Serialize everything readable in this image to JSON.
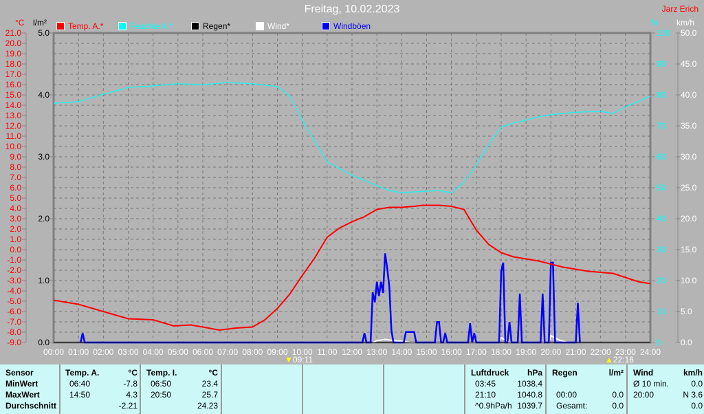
{
  "title": "Freitag, 10.02.2023",
  "author": "Jarz Erich",
  "legend": [
    {
      "label": "Temp. A.*",
      "color": "#ff0000"
    },
    {
      "label": "Feuchte A.*",
      "color": "#00ffff"
    },
    {
      "label": "Regen*",
      "color": "#000000"
    },
    {
      "label": "Wind*",
      "color": "#ffffff"
    },
    {
      "label": "Windböen",
      "color": "#0000ff"
    }
  ],
  "units": {
    "temp": "°C",
    "rain": "l/m²",
    "hum": "%",
    "wind": "km/h"
  },
  "sun": {
    "rise": "09:11",
    "set": "22:16"
  },
  "chart_data": {
    "type": "line",
    "x_ticks": [
      "00:00",
      "01:00",
      "02:00",
      "03:00",
      "04:00",
      "05:00",
      "06:00",
      "07:00",
      "08:00",
      "09:00",
      "10:00",
      "11:00",
      "12:00",
      "13:00",
      "14:00",
      "15:00",
      "16:00",
      "17:00",
      "18:00",
      "19:00",
      "20:00",
      "21:00",
      "22:00",
      "23:00",
      "24:00"
    ],
    "axes": {
      "temp": {
        "label": "°C",
        "range": [
          -9,
          21
        ],
        "step": 1,
        "color": "#ff0000"
      },
      "rain": {
        "label": "l/m²",
        "range": [
          0,
          5
        ],
        "step": 1
      },
      "humidity": {
        "label": "%",
        "range": [
          0,
          100
        ],
        "step": 10,
        "color": "#00ffff"
      },
      "wind": {
        "label": "km/h",
        "range": [
          0,
          50
        ],
        "step": 5
      }
    },
    "grid": true,
    "series": [
      {
        "name": "Temp. A.*",
        "color": "#ff0000",
        "points": [
          [
            "00:00",
            -4.9
          ],
          [
            "01:00",
            -5.3
          ],
          [
            "02:00",
            -6.0
          ],
          [
            "03:00",
            -6.7
          ],
          [
            "04:00",
            -6.8
          ],
          [
            "04:50",
            -7.4
          ],
          [
            "05:30",
            -7.3
          ],
          [
            "06:00",
            -7.5
          ],
          [
            "06:40",
            -7.8
          ],
          [
            "07:20",
            -7.6
          ],
          [
            "08:00",
            -7.5
          ],
          [
            "08:30",
            -6.8
          ],
          [
            "09:00",
            -5.7
          ],
          [
            "09:30",
            -4.3
          ],
          [
            "10:00",
            -2.5
          ],
          [
            "10:30",
            -0.8
          ],
          [
            "11:00",
            1.2
          ],
          [
            "11:30",
            2.1
          ],
          [
            "12:00",
            2.7
          ],
          [
            "12:30",
            3.2
          ],
          [
            "13:00",
            3.9
          ],
          [
            "13:30",
            4.1
          ],
          [
            "14:00",
            4.1
          ],
          [
            "14:30",
            4.2
          ],
          [
            "14:50",
            4.3
          ],
          [
            "15:30",
            4.3
          ],
          [
            "16:00",
            4.2
          ],
          [
            "16:30",
            3.9
          ],
          [
            "17:00",
            1.9
          ],
          [
            "17:30",
            0.5
          ],
          [
            "18:00",
            -0.3
          ],
          [
            "18:30",
            -0.7
          ],
          [
            "19:00",
            -0.9
          ],
          [
            "19:30",
            -1.1
          ],
          [
            "20:00",
            -1.4
          ],
          [
            "20:30",
            -1.7
          ],
          [
            "21:00",
            -1.9
          ],
          [
            "21:30",
            -2.1
          ],
          [
            "22:00",
            -2.2
          ],
          [
            "22:30",
            -2.3
          ],
          [
            "23:00",
            -2.7
          ],
          [
            "23:30",
            -3.1
          ],
          [
            "24:00",
            -3.3
          ]
        ]
      },
      {
        "name": "Feuchte A.*",
        "color": "#00ffff",
        "points": [
          [
            "00:00",
            77.3
          ],
          [
            "01:00",
            77.8
          ],
          [
            "02:00",
            80.2
          ],
          [
            "03:00",
            82.4
          ],
          [
            "04:00",
            82.9
          ],
          [
            "05:00",
            83.6
          ],
          [
            "06:00",
            83.3
          ],
          [
            "07:00",
            84.0
          ],
          [
            "08:00",
            83.6
          ],
          [
            "09:00",
            82.7
          ],
          [
            "09:30",
            79.6
          ],
          [
            "10:00",
            71.8
          ],
          [
            "10:30",
            65.1
          ],
          [
            "11:00",
            58.4
          ],
          [
            "12:00",
            54.0
          ],
          [
            "12:30",
            52.4
          ],
          [
            "13:00",
            50.7
          ],
          [
            "13:30",
            49.1
          ],
          [
            "14:00",
            48.4
          ],
          [
            "15:00",
            48.9
          ],
          [
            "15:30",
            49.1
          ],
          [
            "16:00",
            48.4
          ],
          [
            "16:30",
            51.8
          ],
          [
            "17:00",
            57.3
          ],
          [
            "17:30",
            64.0
          ],
          [
            "18:00",
            69.6
          ],
          [
            "18:30",
            70.9
          ],
          [
            "19:00",
            71.8
          ],
          [
            "19:30",
            72.9
          ],
          [
            "20:00",
            73.6
          ],
          [
            "21:00",
            74.4
          ],
          [
            "22:00",
            74.7
          ],
          [
            "22:30",
            74.0
          ],
          [
            "23:00",
            76.2
          ],
          [
            "23:30",
            77.8
          ],
          [
            "24:00",
            79.6
          ]
        ]
      },
      {
        "name": "Regen*",
        "color": "#000000",
        "points": [
          [
            "00:00",
            0
          ],
          [
            "24:00",
            0
          ]
        ]
      },
      {
        "name": "Wind*",
        "color": "#ffffff",
        "points": [
          [
            "12:50",
            0
          ],
          [
            "13:00",
            0.3
          ],
          [
            "13:20",
            0.5
          ],
          [
            "13:40",
            0.3
          ],
          [
            "14:00",
            0.2
          ],
          [
            "14:20",
            0
          ],
          [
            "17:55",
            0
          ],
          [
            "18:00",
            0.8
          ],
          [
            "18:20",
            0
          ],
          [
            "19:55",
            0
          ],
          [
            "20:00",
            1.1
          ],
          [
            "20:20",
            0.4
          ],
          [
            "20:40",
            0
          ]
        ]
      },
      {
        "name": "Windböen",
        "color": "#0000ff",
        "points": [
          [
            "01:05",
            0
          ],
          [
            "01:10",
            1.5
          ],
          [
            "01:15",
            0
          ],
          [
            "12:25",
            0
          ],
          [
            "12:30",
            1.5
          ],
          [
            "12:35",
            0
          ],
          [
            "12:45",
            0
          ],
          [
            "12:50",
            8.1
          ],
          [
            "12:55",
            6.5
          ],
          [
            "13:00",
            9.8
          ],
          [
            "13:05",
            7.5
          ],
          [
            "13:10",
            9.8
          ],
          [
            "13:15",
            8.0
          ],
          [
            "13:20",
            14.4
          ],
          [
            "13:25",
            12.0
          ],
          [
            "13:30",
            9.0
          ],
          [
            "13:35",
            2.0
          ],
          [
            "13:40",
            0
          ],
          [
            "14:05",
            0
          ],
          [
            "14:10",
            1.7
          ],
          [
            "14:30",
            1.7
          ],
          [
            "14:35",
            0
          ],
          [
            "15:20",
            0
          ],
          [
            "15:25",
            3.3
          ],
          [
            "15:30",
            3.3
          ],
          [
            "15:35",
            0
          ],
          [
            "15:40",
            0
          ],
          [
            "15:45",
            1.5
          ],
          [
            "15:50",
            0
          ],
          [
            "16:40",
            0
          ],
          [
            "16:45",
            3.1
          ],
          [
            "16:50",
            0
          ],
          [
            "16:55",
            1.5
          ],
          [
            "17:00",
            0
          ],
          [
            "17:55",
            0
          ],
          [
            "18:00",
            11.5
          ],
          [
            "18:05",
            12.9
          ],
          [
            "18:10",
            0
          ],
          [
            "18:15",
            0
          ],
          [
            "18:20",
            3.3
          ],
          [
            "18:25",
            0
          ],
          [
            "18:40",
            0
          ],
          [
            "18:45",
            7.9
          ],
          [
            "18:50",
            0
          ],
          [
            "19:35",
            0
          ],
          [
            "19:40",
            7.9
          ],
          [
            "19:45",
            0
          ],
          [
            "19:55",
            0
          ],
          [
            "20:00",
            12.9
          ],
          [
            "20:05",
            12.9
          ],
          [
            "20:10",
            0
          ],
          [
            "21:00",
            0
          ],
          [
            "21:05",
            6.4
          ],
          [
            "21:10",
            0
          ]
        ]
      }
    ]
  },
  "table": {
    "cols": [
      {
        "rows": [
          "Sensor",
          "MinWert",
          "MaxWert",
          "Durchschnitt"
        ]
      },
      {
        "head": "Temp. A.",
        "unit": "°C",
        "times": [
          "06:40",
          "14:50",
          ""
        ],
        "values": [
          "-7.8",
          "4.3",
          "-2.21"
        ]
      },
      {
        "head": "Temp. I.",
        "unit": "°C",
        "times": [
          "06:50",
          "20:50",
          ""
        ],
        "values": [
          "23.4",
          "25.7",
          "24.23"
        ]
      },
      {
        "head": "Luftdruck",
        "unit": "hPa",
        "times": [
          "03:45",
          "21:10",
          "^0.9hPa/h"
        ],
        "values": [
          "1038.4",
          "1040.8",
          "1039.7"
        ]
      },
      {
        "head": "Regen",
        "unit": "l/m²",
        "times": [
          "",
          "00:00",
          "Gesamt:"
        ],
        "values": [
          "",
          "0.0",
          "0.0"
        ]
      },
      {
        "head": "Wind",
        "unit": "km/h",
        "times": [
          "Ø 10 min.",
          "20:00",
          ""
        ],
        "values": [
          "0.0",
          "N 3.6",
          "0.0"
        ]
      }
    ]
  }
}
